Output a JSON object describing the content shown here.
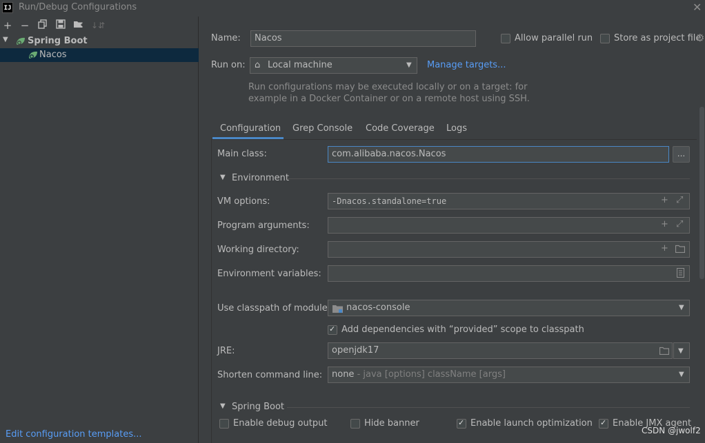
{
  "window": {
    "title": "Run/Debug Configurations",
    "app_icon": "IJ"
  },
  "toolbar": {
    "icons": [
      "add-icon",
      "remove-icon",
      "copy-icon",
      "save-icon",
      "folder-add-icon",
      "sort-icon"
    ]
  },
  "tree": {
    "parent": "Spring Boot",
    "child": "Nacos"
  },
  "left_footer": {
    "templates_link": "Edit configuration templates..."
  },
  "header": {
    "name_label": "Name:",
    "name_value": "Nacos",
    "allow_parallel": "Allow parallel run",
    "store_as_project": "Store as project file",
    "run_on_label": "Run on:",
    "run_on_value": "Local machine",
    "manage_targets": "Manage targets...",
    "hint_line1": "Run configurations may be executed locally or on a target: for",
    "hint_line2": "example in a Docker Container or on a remote host using SSH."
  },
  "tabs": [
    "Configuration",
    "Grep Console",
    "Code Coverage",
    "Logs"
  ],
  "config": {
    "main_class_label": "Main class:",
    "main_class_value": "com.alibaba.nacos.Nacos",
    "dots": "...",
    "environment_section": "Environment",
    "vm_options_label": "VM options:",
    "vm_options_value": "-Dnacos.standalone=true",
    "program_args_label": "Program arguments:",
    "working_dir_label": "Working directory:",
    "env_vars_label": "Environment variables:",
    "classpath_label": "Use classpath of module:",
    "classpath_value": "nacos-console",
    "add_deps_label": "Add dependencies with “provided” scope to classpath",
    "jre_label": "JRE:",
    "jre_value": "openjdk17",
    "shorten_label": "Shorten command line:",
    "shorten_value": "none",
    "shorten_hint": " - java [options] className [args]",
    "spring_boot_section": "Spring Boot",
    "enable_debug": "Enable debug output",
    "hide_banner": "Hide banner",
    "enable_launch": "Enable launch optimization",
    "enable_jmx": "Enable JMX agent",
    "add_deps_checked": true,
    "enable_launch_checked": true,
    "enable_jmx_checked": true
  },
  "watermark": "CSDN @jwolf2"
}
